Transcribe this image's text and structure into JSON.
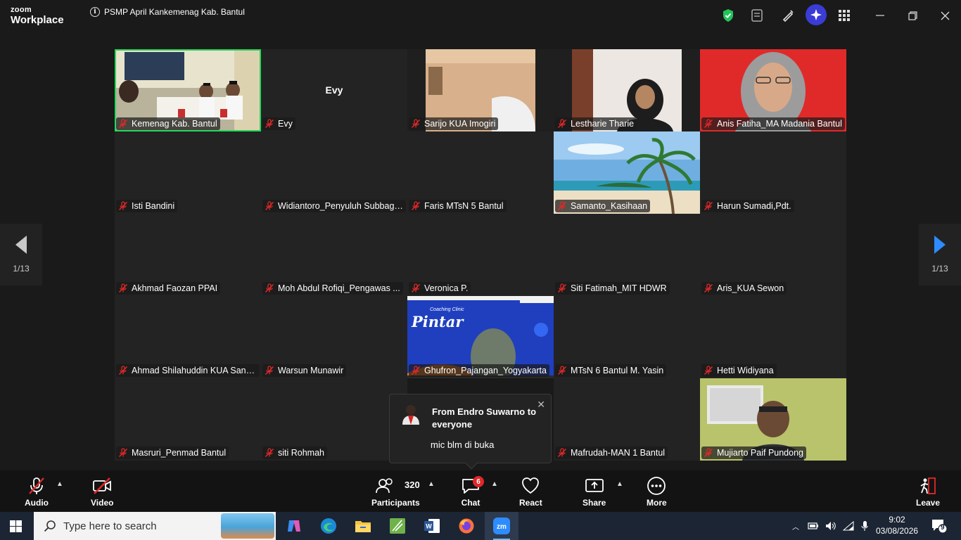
{
  "app": {
    "logo_line1": "zoom",
    "logo_line2": "Workplace",
    "meeting_title": "PSMP April Kankemenag Kab. Bantul"
  },
  "titlebar_icons": [
    "shield-check-icon",
    "notes-icon",
    "whiteboard-pen-icon",
    "ai-companion-icon",
    "apps-grid-icon",
    "minimize-icon",
    "restore-icon",
    "close-icon"
  ],
  "colors": {
    "accent_green": "#23d959",
    "muted_red": "#e02828",
    "pager_blue": "#2d8cff"
  },
  "pager": {
    "left_label": "1/13",
    "right_label": "1/13"
  },
  "tiles": [
    {
      "name": "Kemenag Kab. Bantul",
      "video": true,
      "active": true,
      "tile_id": "kemenag"
    },
    {
      "name": "Evy",
      "video": false,
      "center": "Evy"
    },
    {
      "name": "Sarijo KUA Imogiri",
      "video": true,
      "tile_id": "sarijo"
    },
    {
      "name": "Lestharie Tharie",
      "video": true,
      "tile_id": "lestharie"
    },
    {
      "name": "Anis Fatiha_MA Madania Bantul",
      "video": true,
      "tile_id": "anis"
    },
    {
      "name": "Isti Bandini",
      "video": false
    },
    {
      "name": "Widiantoro_Penyuluh Subbag ...",
      "video": false
    },
    {
      "name": "Faris MTsN 5  Bantul",
      "video": false
    },
    {
      "name": "Samanto_Kasihaan",
      "video": true,
      "tile_id": "beach"
    },
    {
      "name": "Harun Sumadi,Pdt.",
      "video": false
    },
    {
      "name": "Akhmad Faozan PPAI",
      "video": false
    },
    {
      "name": "Moh Abdul Rofiqi_Pengawas ...",
      "video": false
    },
    {
      "name": "Veronica P.",
      "video": false
    },
    {
      "name": "Siti Fatimah_MIT HDWR",
      "video": false
    },
    {
      "name": "Aris_KUA Sewon",
      "video": false
    },
    {
      "name": "Ahmad Shilahuddin KUA Sand...",
      "video": false
    },
    {
      "name": "Warsun Munawir",
      "video": false
    },
    {
      "name": "Ghufron_Pajangan_Yogyakarta",
      "video": true,
      "tile_id": "pintar",
      "slide_text": "Pintar",
      "slide_small": "Coaching Clinic"
    },
    {
      "name": "MTsN 6 Bantul M. Yasin",
      "video": false
    },
    {
      "name": "Hetti Widiyana",
      "video": false
    },
    {
      "name": "Masruri_Penmad Bantul",
      "video": false
    },
    {
      "name": "siti Rohmah",
      "video": false
    },
    {
      "name": "",
      "video": false,
      "hidden": true
    },
    {
      "name": "Mafrudah-MAN 1 Bantul",
      "video": false
    },
    {
      "name": "Mujiarto Paif Pundong",
      "video": true,
      "tile_id": "mujiarto"
    }
  ],
  "chat_popup": {
    "from": "From Endro Suwarno to everyone",
    "message": "mic blm di buka"
  },
  "toolbar": {
    "audio": "Audio",
    "video": "Video",
    "participants": "Participants",
    "participants_count": "320",
    "chat": "Chat",
    "chat_badge": "6",
    "react": "React",
    "share": "Share",
    "more": "More",
    "leave": "Leave"
  },
  "taskbar": {
    "search_placeholder": "Type here to search",
    "apps": [
      "copilot-icon",
      "edge-icon",
      "file-explorer-icon",
      "excel-like-app-icon",
      "word-icon",
      "firefox-icon",
      "zoom-icon"
    ],
    "time": "9:02",
    "date": "03/08/2026",
    "notification_count": "9"
  }
}
